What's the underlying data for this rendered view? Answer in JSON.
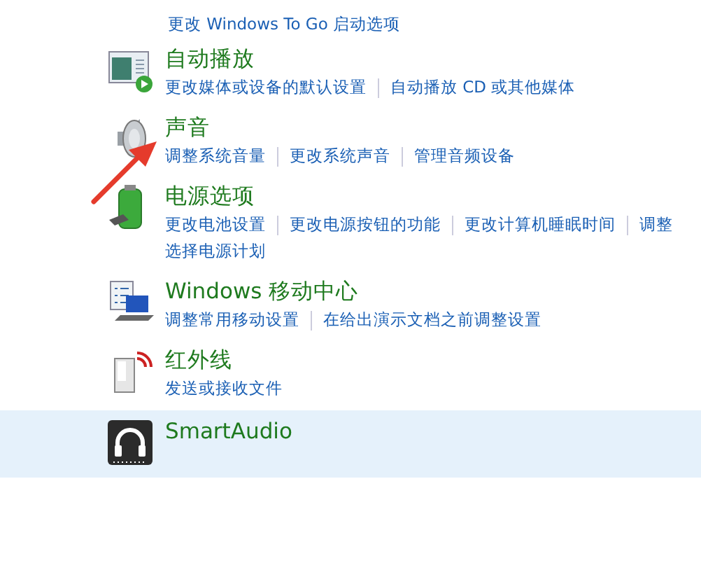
{
  "top_links": [
    "更改 Windows To Go 启动选项"
  ],
  "categories": [
    {
      "title": "自动播放",
      "highlighted": false,
      "link_lines": [
        [
          "更改媒体或设备的默认设置",
          "自动播放 CD 或其他媒体"
        ]
      ]
    },
    {
      "title": "声音",
      "highlighted": false,
      "link_lines": [
        [
          "调整系统音量",
          "更改系统声音",
          "管理音频设备"
        ]
      ]
    },
    {
      "title": "电源选项",
      "highlighted": false,
      "link_lines": [
        [
          "更改电池设置",
          "更改电源按钮的功能",
          "更改计算机睡眠时间",
          "调整"
        ],
        [
          "选择电源计划"
        ]
      ]
    },
    {
      "title": "Windows 移动中心",
      "highlighted": false,
      "link_lines": [
        [
          "调整常用移动设置",
          "在给出演示文档之前调整设置"
        ]
      ]
    },
    {
      "title": "红外线",
      "highlighted": false,
      "link_lines": [
        [
          "发送或接收文件"
        ]
      ]
    },
    {
      "title": "SmartAudio",
      "highlighted": true
    }
  ],
  "annotations": [
    {
      "kind": "arrow"
    }
  ]
}
